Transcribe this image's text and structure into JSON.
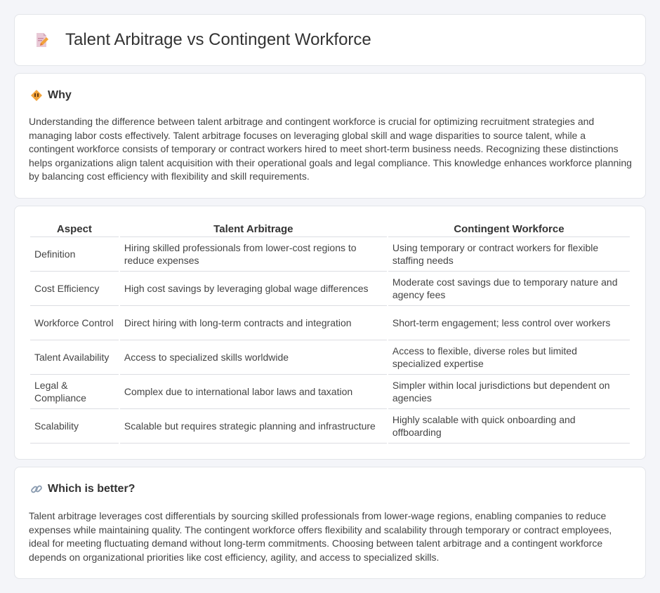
{
  "header": {
    "title": "Talent Arbitrage vs Contingent Workforce",
    "icon": "document-edit-icon"
  },
  "why": {
    "heading": "Why",
    "icon": "warning-diamond-icon",
    "text": "Understanding the difference between talent arbitrage and contingent workforce is crucial for optimizing recruitment strategies and managing labor costs effectively. Talent arbitrage focuses on leveraging global skill and wage disparities to source talent, while a contingent workforce consists of temporary or contract workers hired to meet short-term business needs. Recognizing these distinctions helps organizations align talent acquisition with their operational goals and legal compliance. This knowledge enhances workforce planning by balancing cost efficiency with flexibility and skill requirements."
  },
  "table": {
    "headers": [
      "Aspect",
      "Talent Arbitrage",
      "Contingent Workforce"
    ],
    "rows": [
      [
        "Definition",
        "Hiring skilled professionals from lower-cost regions to reduce expenses",
        "Using temporary or contract workers for flexible staffing needs"
      ],
      [
        "Cost Efficiency",
        "High cost savings by leveraging global wage differences",
        "Moderate cost savings due to temporary nature and agency fees"
      ],
      [
        "Workforce Control",
        "Direct hiring with long-term contracts and integration",
        "Short-term engagement; less control over workers"
      ],
      [
        "Talent Availability",
        "Access to specialized skills worldwide",
        "Access to flexible, diverse roles but limited specialized expertise"
      ],
      [
        "Legal & Compliance",
        "Complex due to international labor laws and taxation",
        "Simpler within local jurisdictions but dependent on agencies"
      ],
      [
        "Scalability",
        "Scalable but requires strategic planning and infrastructure",
        "Highly scalable with quick onboarding and offboarding"
      ]
    ]
  },
  "better": {
    "heading": "Which is better?",
    "icon": "link-icon",
    "text": "Talent arbitrage leverages cost differentials by sourcing skilled professionals from lower-wage regions, enabling companies to reduce expenses while maintaining quality. The contingent workforce offers flexibility and scalability through temporary or contract employees, ideal for meeting fluctuating demand without long-term commitments. Choosing between talent arbitrage and a contingent workforce depends on organizational priorities like cost efficiency, agility, and access to specialized skills."
  }
}
